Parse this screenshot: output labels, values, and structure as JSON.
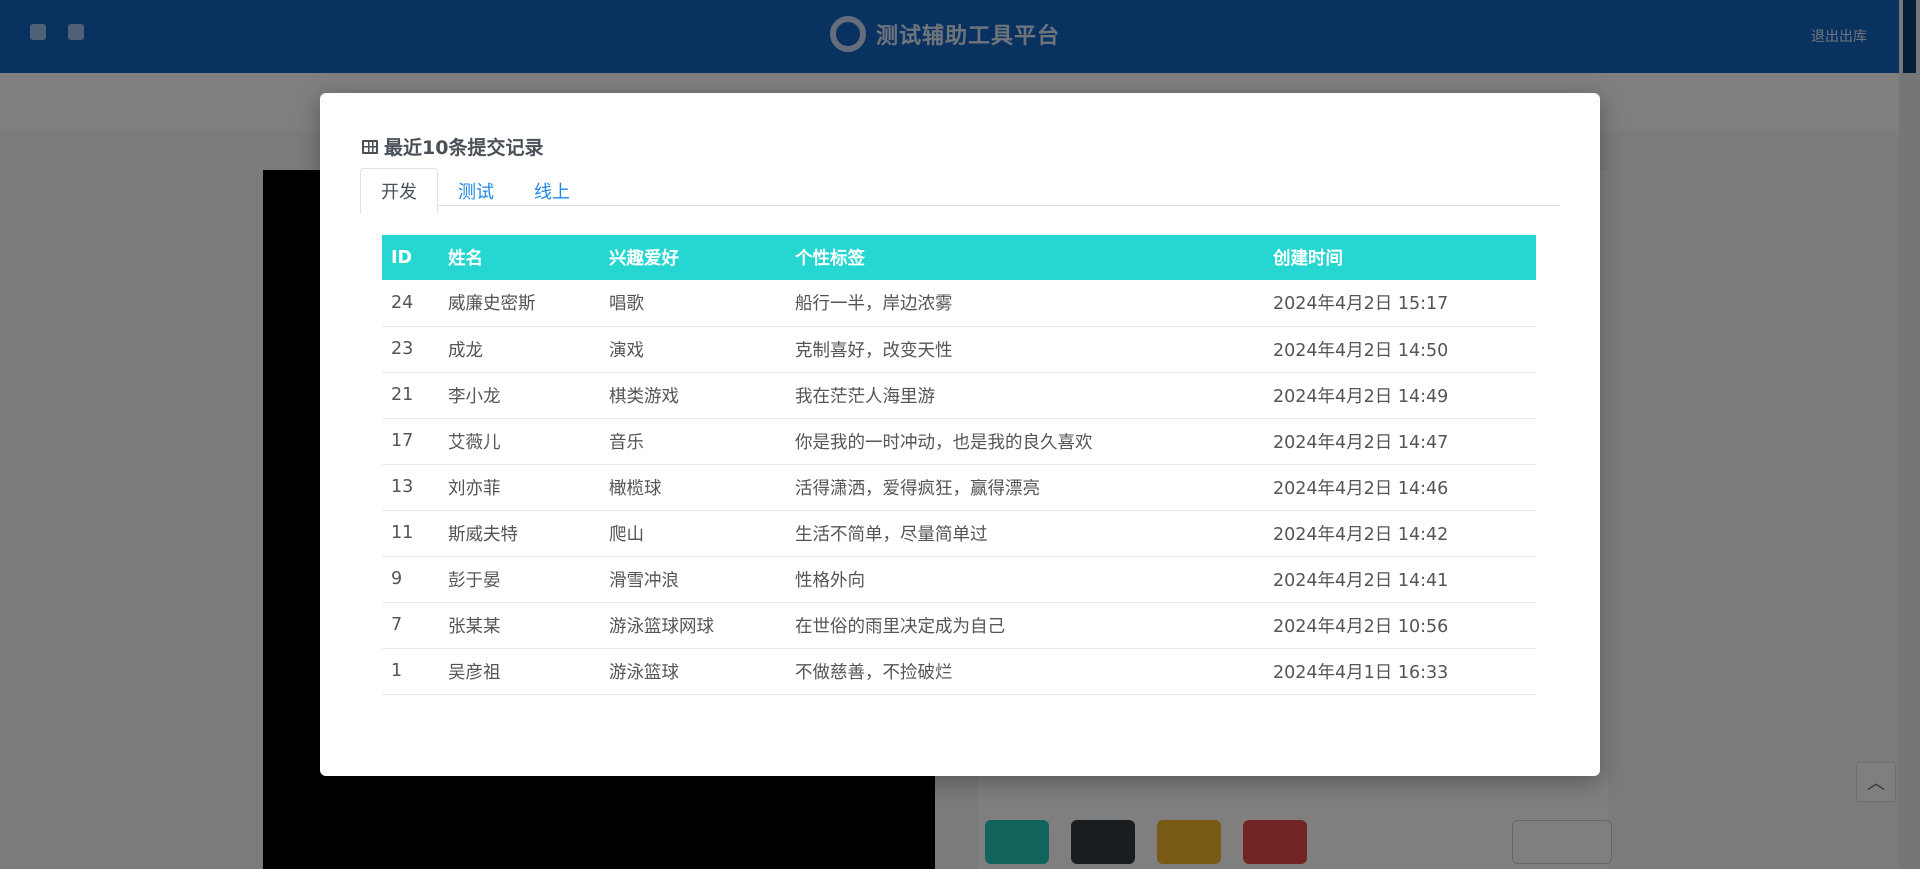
{
  "app": {
    "brand_title": "测试辅助工具平台",
    "logout_label": "退出出库"
  },
  "modal": {
    "title": "最近10条提交记录",
    "tabs": [
      {
        "label": "开发",
        "active": true
      },
      {
        "label": "测试",
        "active": false
      },
      {
        "label": "线上",
        "active": false
      }
    ],
    "table": {
      "headers": {
        "id": "ID",
        "name": "姓名",
        "hobby": "兴趣爱好",
        "tag": "个性标签",
        "created": "创建时间"
      },
      "rows": [
        {
          "id": "24",
          "name": "威廉史密斯",
          "hobby": "唱歌",
          "tag": "船行一半，岸边浓雾",
          "created": "2024年4月2日 15:17"
        },
        {
          "id": "23",
          "name": "成龙",
          "hobby": "演戏",
          "tag": "克制喜好，改变天性",
          "created": "2024年4月2日 14:50"
        },
        {
          "id": "21",
          "name": "李小龙",
          "hobby": "棋类游戏",
          "tag": "我在茫茫人海里游",
          "created": "2024年4月2日 14:49"
        },
        {
          "id": "17",
          "name": "艾薇儿",
          "hobby": "音乐",
          "tag": "你是我的一时冲动，也是我的良久喜欢",
          "created": "2024年4月2日 14:47"
        },
        {
          "id": "13",
          "name": "刘亦菲",
          "hobby": "橄榄球",
          "tag": "活得潇洒，爱得疯狂，赢得漂亮",
          "created": "2024年4月2日 14:46"
        },
        {
          "id": "11",
          "name": "斯威夫特",
          "hobby": "爬山",
          "tag": "生活不简单，尽量简单过",
          "created": "2024年4月2日 14:42"
        },
        {
          "id": "9",
          "name": "彭于晏",
          "hobby": "滑雪冲浪",
          "tag": "性格外向",
          "created": "2024年4月2日 14:41"
        },
        {
          "id": "7",
          "name": "张某某",
          "hobby": "游泳篮球网球",
          "tag": "在世俗的雨里决定成为自己",
          "created": "2024年4月2日 10:56"
        },
        {
          "id": "1",
          "name": "吴彦祖",
          "hobby": "游泳篮球",
          "tag": "不做慈善，不捡破烂",
          "created": "2024年4月1日 16:33"
        }
      ]
    }
  },
  "colors": {
    "header_bar": "#1565c0",
    "table_header": "#26d7d1",
    "tab_link": "#1e88e5"
  }
}
